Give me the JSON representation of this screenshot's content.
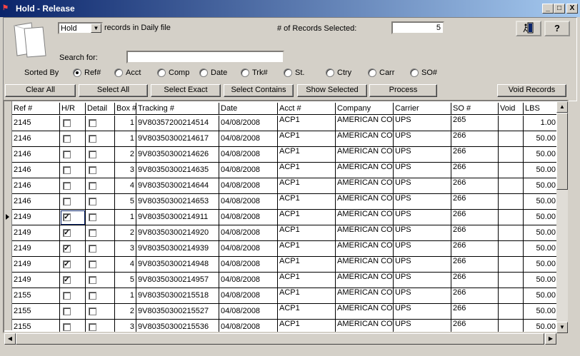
{
  "window": {
    "title": "Hold - Release",
    "app_icon": "app-icon",
    "min": "_",
    "max": "□",
    "close": "X"
  },
  "top": {
    "mode_select": "Hold",
    "records_in_label": "records in Daily file",
    "records_selected_label": "# of Records Selected:",
    "records_selected_value": "5",
    "exit_icon": "exit-door-icon",
    "help_icon": "help-icon",
    "help_glyph": "?"
  },
  "search": {
    "label": "Search for:",
    "value": ""
  },
  "sort": {
    "label": "Sorted By",
    "options": [
      "Ref#",
      "Acct",
      "Comp",
      "Date",
      "Trk#",
      "St.",
      "Ctry",
      "Carr",
      "SO#"
    ],
    "selected": "Ref#"
  },
  "buttons": {
    "clear_all": "Clear All",
    "select_all": "Select All",
    "select_exact": "Select Exact",
    "select_contains": "Select Contains",
    "show_selected": "Show Selected",
    "process": "Process",
    "void_records": "Void Records"
  },
  "table": {
    "columns": [
      "Ref #",
      "H/R",
      "Detail",
      "Box #",
      "Tracking #",
      "Date",
      "Acct #",
      "Company",
      "Carrier",
      "SO #",
      "Void",
      "LBS"
    ],
    "rows": [
      {
        "ref": "2145",
        "hr": false,
        "detail": false,
        "box": "1",
        "tracking": "9V80357200214514",
        "date": "04/08/2008",
        "acct": "ACP1",
        "company": "AMERICAN COMPANY",
        "carrier": "UPS",
        "so": "265",
        "void": "",
        "lbs": "1.00"
      },
      {
        "ref": "2146",
        "hr": false,
        "detail": false,
        "box": "1",
        "tracking": "9V80350300214617",
        "date": "04/08/2008",
        "acct": "ACP1",
        "company": "AMERICAN COMPANY",
        "carrier": "UPS",
        "so": "266",
        "void": "",
        "lbs": "50.00"
      },
      {
        "ref": "2146",
        "hr": false,
        "detail": false,
        "box": "2",
        "tracking": "9V80350300214626",
        "date": "04/08/2008",
        "acct": "ACP1",
        "company": "AMERICAN COMPANY",
        "carrier": "UPS",
        "so": "266",
        "void": "",
        "lbs": "50.00"
      },
      {
        "ref": "2146",
        "hr": false,
        "detail": false,
        "box": "3",
        "tracking": "9V80350300214635",
        "date": "04/08/2008",
        "acct": "ACP1",
        "company": "AMERICAN COMPANY",
        "carrier": "UPS",
        "so": "266",
        "void": "",
        "lbs": "50.00"
      },
      {
        "ref": "2146",
        "hr": false,
        "detail": false,
        "box": "4",
        "tracking": "9V80350300214644",
        "date": "04/08/2008",
        "acct": "ACP1",
        "company": "AMERICAN COMPANY",
        "carrier": "UPS",
        "so": "266",
        "void": "",
        "lbs": "50.00"
      },
      {
        "ref": "2146",
        "hr": false,
        "detail": false,
        "box": "5",
        "tracking": "9V80350300214653",
        "date": "04/08/2008",
        "acct": "ACP1",
        "company": "AMERICAN COMPANY",
        "carrier": "UPS",
        "so": "266",
        "void": "",
        "lbs": "50.00"
      },
      {
        "ref": "2149",
        "hr": true,
        "detail": false,
        "box": "1",
        "tracking": "9V80350300214911",
        "date": "04/08/2008",
        "acct": "ACP1",
        "company": "AMERICAN COMPANY",
        "carrier": "UPS",
        "so": "266",
        "void": "",
        "lbs": "50.00",
        "current": true
      },
      {
        "ref": "2149",
        "hr": true,
        "detail": false,
        "box": "2",
        "tracking": "9V80350300214920",
        "date": "04/08/2008",
        "acct": "ACP1",
        "company": "AMERICAN COMPANY",
        "carrier": "UPS",
        "so": "266",
        "void": "",
        "lbs": "50.00"
      },
      {
        "ref": "2149",
        "hr": true,
        "detail": false,
        "box": "3",
        "tracking": "9V80350300214939",
        "date": "04/08/2008",
        "acct": "ACP1",
        "company": "AMERICAN COMPANY",
        "carrier": "UPS",
        "so": "266",
        "void": "",
        "lbs": "50.00"
      },
      {
        "ref": "2149",
        "hr": true,
        "detail": false,
        "box": "4",
        "tracking": "9V80350300214948",
        "date": "04/08/2008",
        "acct": "ACP1",
        "company": "AMERICAN COMPANY",
        "carrier": "UPS",
        "so": "266",
        "void": "",
        "lbs": "50.00"
      },
      {
        "ref": "2149",
        "hr": true,
        "detail": false,
        "box": "5",
        "tracking": "9V80350300214957",
        "date": "04/08/2008",
        "acct": "ACP1",
        "company": "AMERICAN COMPANY",
        "carrier": "UPS",
        "so": "266",
        "void": "",
        "lbs": "50.00"
      },
      {
        "ref": "2155",
        "hr": false,
        "detail": false,
        "box": "1",
        "tracking": "9V80350300215518",
        "date": "04/08/2008",
        "acct": "ACP1",
        "company": "AMERICAN COMPANY",
        "carrier": "UPS",
        "so": "266",
        "void": "",
        "lbs": "50.00"
      },
      {
        "ref": "2155",
        "hr": false,
        "detail": false,
        "box": "2",
        "tracking": "9V80350300215527",
        "date": "04/08/2008",
        "acct": "ACP1",
        "company": "AMERICAN COMPANY",
        "carrier": "UPS",
        "so": "266",
        "void": "",
        "lbs": "50.00"
      },
      {
        "ref": "2155",
        "hr": false,
        "detail": false,
        "box": "3",
        "tracking": "9V80350300215536",
        "date": "04/08/2008",
        "acct": "ACP1",
        "company": "AMERICAN COMPANY",
        "carrier": "UPS",
        "so": "266",
        "void": "",
        "lbs": "50.00"
      }
    ]
  },
  "colors": {
    "titlebar_start": "#0a246a",
    "titlebar_end": "#a6caf0",
    "face": "#d4d0c8"
  }
}
